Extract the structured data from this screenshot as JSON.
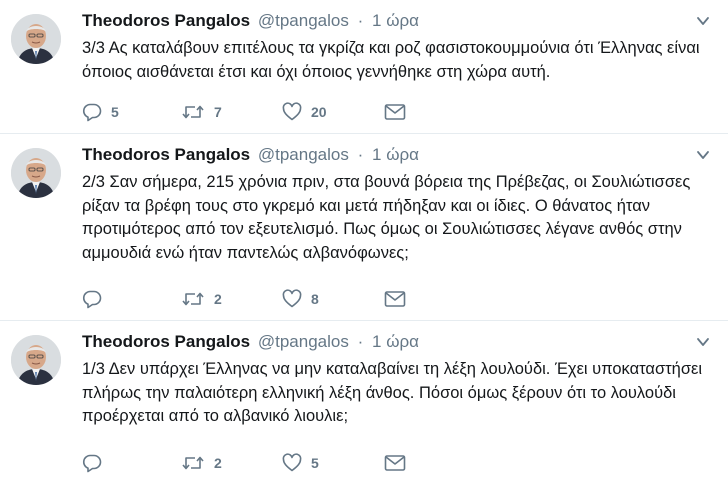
{
  "tweets": [
    {
      "author_name": "Theodoros Pangalos",
      "handle": "@tpangalos",
      "separator": "·",
      "time": "1 ώρα",
      "text": "3/3 Ας καταλάβουν επιτέλους τα γκρίζα και ροζ φασιστοκουμμούνια ότι Έλληνας είναι όποιος αισθάνεται έτσι και όχι όποιος γεννήθηκε στη χώρα αυτή.",
      "replies": "5",
      "retweets": "7",
      "likes": "20"
    },
    {
      "author_name": "Theodoros Pangalos",
      "handle": "@tpangalos",
      "separator": "·",
      "time": "1 ώρα",
      "text": "2/3 Σαν σήμερα, 215 χρόνια πριν, στα βουνά βόρεια της Πρέβεζας, οι Σουλιώτισσες ρίξαν τα βρέφη τους στο γκρεμό και μετά πήδηξαν και οι ίδιες. Ο θάνατος ήταν προτιμότερος από τον εξευτελισμό. Πως όμως οι Σουλιώτισσες λέγανε ανθός στην αμμουδιά ενώ ήταν παντελώς αλβανόφωνες;",
      "replies": "",
      "retweets": "2",
      "likes": "8"
    },
    {
      "author_name": "Theodoros Pangalos",
      "handle": "@tpangalos",
      "separator": "·",
      "time": "1 ώρα",
      "text": "1/3 Δεν υπάρχει Έλληνας να μην καταλαβαίνει τη λέξη λουλούδι. Έχει υποκαταστήσει πλήρως την παλαιότερη ελληνική λέξη άνθος. Πόσοι όμως ξέρουν ότι το λουλούδι προέρχεται από το αλβανικό λιουλιε;",
      "replies": "",
      "retweets": "2",
      "likes": "5"
    }
  ],
  "colors": {
    "text": "#14171a",
    "secondary": "#657786",
    "divider": "#e6ecf0"
  },
  "icons": {
    "reply": "reply-icon",
    "retweet": "retweet-icon",
    "like": "heart-icon",
    "dm": "envelope-icon",
    "menu": "chevron-down-icon"
  }
}
